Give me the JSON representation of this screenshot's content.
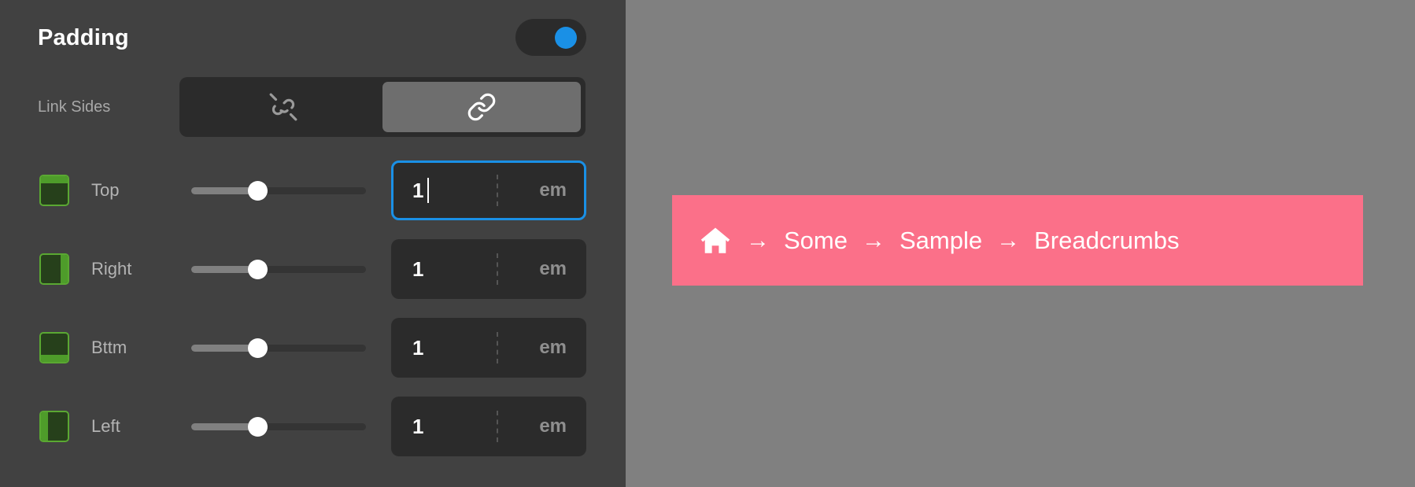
{
  "panel": {
    "title": "Padding",
    "enabled_toggle": {
      "name": "padding-enabled-toggle",
      "state": "on",
      "accent_color": "#1a90e6"
    },
    "link_sides": {
      "label": "Link Sides",
      "options": [
        {
          "icon": "link-broken-icon",
          "label": "Unlinked",
          "selected": false
        },
        {
          "icon": "link-icon",
          "label": "Linked",
          "selected": true
        }
      ]
    },
    "rows": [
      {
        "side": "top",
        "label": "Top",
        "swatch_icon": "border-top-icon",
        "slider": {
          "percent": 38
        },
        "value": "1",
        "unit": "em",
        "focused": true
      },
      {
        "side": "right",
        "label": "Right",
        "swatch_icon": "border-right-icon",
        "slider": {
          "percent": 38
        },
        "value": "1",
        "unit": "em",
        "focused": false
      },
      {
        "side": "bottom",
        "label": "Bttm",
        "swatch_icon": "border-bottom-icon",
        "slider": {
          "percent": 38
        },
        "value": "1",
        "unit": "em",
        "focused": false
      },
      {
        "side": "left",
        "label": "Left",
        "swatch_icon": "border-left-icon",
        "slider": {
          "percent": 38
        },
        "value": "1",
        "unit": "em",
        "focused": false
      }
    ]
  },
  "preview": {
    "background_color": "#808080",
    "breadcrumb": {
      "background_color": "#fb7089",
      "text_color": "#ffffff",
      "separator": "→",
      "home_icon": "home-icon",
      "items": [
        {
          "label": "Some"
        },
        {
          "label": "Sample"
        },
        {
          "label": "Breadcrumbs"
        }
      ]
    }
  },
  "colors": {
    "sidebar_bg": "#414141",
    "field_bg": "#2b2b2b",
    "swatch_border": "#5aa832",
    "swatch_fill": "#26401b",
    "swatch_bar": "#4e9c2a"
  }
}
